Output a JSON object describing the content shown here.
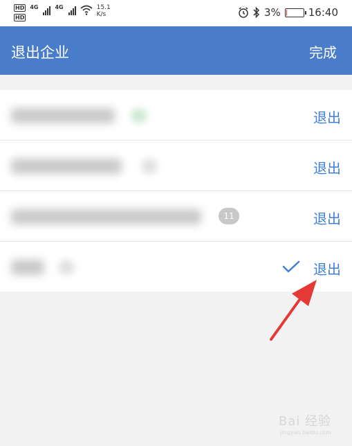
{
  "status_bar": {
    "hd1": "HD",
    "hd2": "HD",
    "net1": "4G",
    "net2": "4G",
    "speed_top": "15.1",
    "speed_bottom": "K/s",
    "battery": "3%",
    "battery_level": 0.03,
    "time": "16:40",
    "icons": [
      "alarm-icon",
      "bluetooth-icon",
      "battery-icon",
      "wifi-icon",
      "signal-icon"
    ]
  },
  "header": {
    "title": "退出企业",
    "done_label": "完成",
    "background_color": "#4a7dc9"
  },
  "list": {
    "items": [
      {
        "exit_label": "退出"
      },
      {
        "exit_label": "退出"
      },
      {
        "exit_label": "退出",
        "badge": "11"
      },
      {
        "exit_label": "退出",
        "checked": true
      }
    ],
    "accent_color": "#3f7fd9"
  },
  "annotation": {
    "arrow_color": "#e53935"
  },
  "watermark": {
    "brand": "Bai 经验",
    "url": "jingyan.baidu.com"
  }
}
